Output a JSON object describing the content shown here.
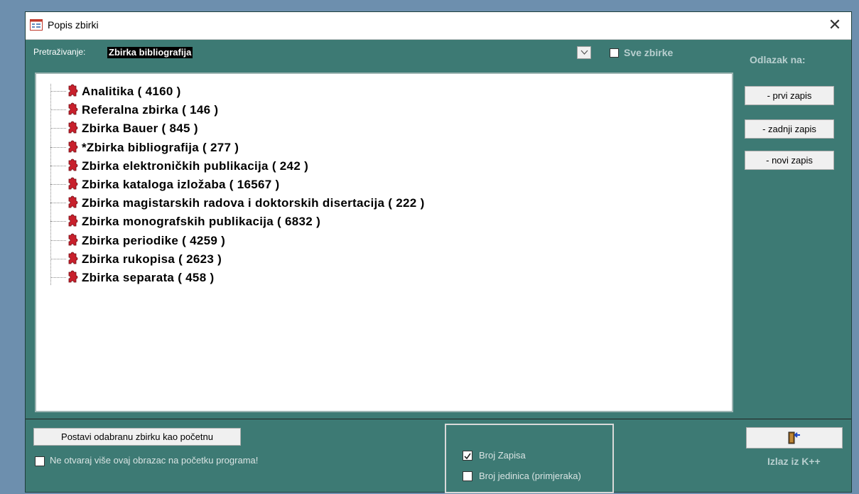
{
  "window": {
    "title": "Popis zbirki",
    "close_glyph": "✕"
  },
  "search": {
    "label": "Pretraživanje:",
    "value": "Zbirka bibliografija"
  },
  "all_collections": {
    "label": "Sve zbirke",
    "checked": false
  },
  "goto": {
    "label": "Odlazak na:",
    "buttons": [
      "- prvi zapis",
      "- zadnji zapis",
      "- novi zapis"
    ]
  },
  "tree": {
    "icon": "puzzle-icon",
    "items": [
      "Analitika ( 4160 )",
      "Referalna zbirka ( 146 )",
      "Zbirka Bauer ( 845 )",
      "*Zbirka bibliografija ( 277 )",
      "Zbirka elektroničkih publikacija ( 242 )",
      "Zbirka kataloga izložaba ( 16567 )",
      "Zbirka magistarskih radova i doktorskih disertacija ( 222 )",
      "Zbirka monografskih publikacija ( 6832 )",
      "Zbirka periodike ( 4259 )",
      "Zbirka rukopisa ( 2623 )",
      "Zbirka separata ( 458 )"
    ]
  },
  "footer": {
    "set_start_button": "Postavi odabranu zbirku kao početnu",
    "no_open_label": "Ne otvaraj više ovaj obrazac na početku programa!",
    "no_open_checked": false,
    "count_records": {
      "label": "Broj Zapisa",
      "checked": true
    },
    "count_units": {
      "label": "Broj jedinica (primjeraka)",
      "checked": false
    },
    "exit_label": "Izlaz iz K++"
  },
  "colors": {
    "window_bg": "#3d7a74",
    "icon_red": "#c8202c"
  }
}
